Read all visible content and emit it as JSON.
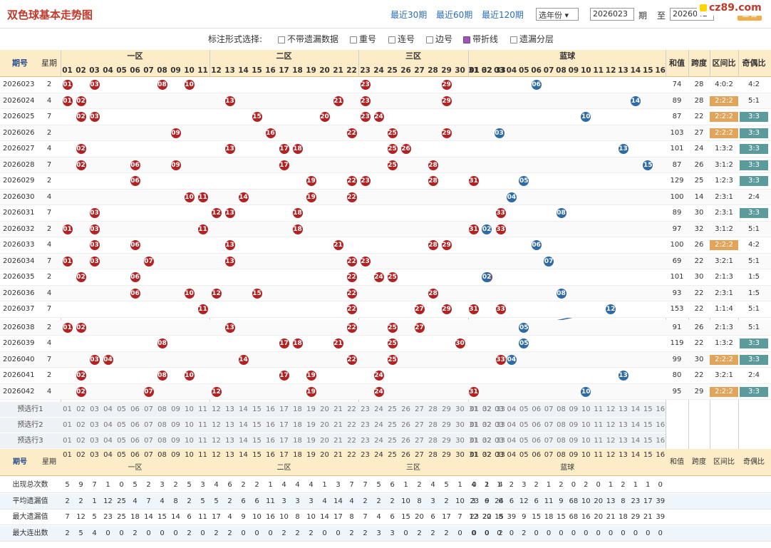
{
  "header": {
    "title": "双色球基本走势图",
    "recent": [
      "最近30期",
      "最近60期",
      "最近120期"
    ],
    "year_select": "选年份",
    "from_issue": "2026023",
    "issue_unit": "期",
    "to_label": "至",
    "to_issue": "2026042",
    "query": "查看",
    "watermark": "cz89.com"
  },
  "options": {
    "label": "标注形式选择:",
    "items": [
      {
        "label": "不带遗漏数据",
        "checked": false
      },
      {
        "label": "重号",
        "checked": false
      },
      {
        "label": "连号",
        "checked": false
      },
      {
        "label": "边号",
        "checked": false
      },
      {
        "label": "带折线",
        "checked": true
      },
      {
        "label": "遗漏分层",
        "checked": false
      }
    ]
  },
  "table": {
    "issue_header": "期号",
    "week_header": "星期",
    "zones": [
      "一区",
      "二区",
      "三区",
      "蓝球"
    ],
    "sum_header": "和值",
    "span_header": "跨度",
    "zone_ratio_header": "区间比",
    "odd_even_header": "奇偶比",
    "red_numbers": [
      "01",
      "02",
      "03",
      "04",
      "05",
      "06",
      "07",
      "08",
      "09",
      "10",
      "11",
      "12",
      "13",
      "14",
      "15",
      "16",
      "17",
      "18",
      "19",
      "20",
      "21",
      "22",
      "23",
      "24",
      "25",
      "26",
      "27",
      "28",
      "29",
      "30",
      "31",
      "32",
      "33"
    ],
    "blue_numbers": [
      "01",
      "02",
      "03",
      "04",
      "05",
      "06",
      "07",
      "08",
      "09",
      "10",
      "11",
      "12",
      "13",
      "14",
      "15",
      "16"
    ],
    "rows": [
      {
        "issue": "2026023",
        "week": "2",
        "red": [
          1,
          3,
          8,
          10,
          23,
          29
        ],
        "blue": 6,
        "sum": "74",
        "span": "28",
        "zone": "4:0:2",
        "oe": "4:2"
      },
      {
        "issue": "2026024",
        "week": "4",
        "red": [
          1,
          2,
          13,
          21,
          23,
          29
        ],
        "blue": 14,
        "sum": "89",
        "span": "28",
        "zone": "2:2:2",
        "oe": "5:1"
      },
      {
        "issue": "2026025",
        "week": "7",
        "red": [
          2,
          3,
          15,
          20,
          23,
          24
        ],
        "blue": 10,
        "sum": "87",
        "span": "22",
        "zone": "2:2:2",
        "oe": "3:3"
      },
      {
        "issue": "2026026",
        "week": "2",
        "red": [
          9,
          16,
          22,
          25,
          29
        ],
        "blue": 3,
        "sum": "103",
        "span": "27",
        "zone": "2:2:2",
        "oe": "3:3"
      },
      {
        "issue": "2026027",
        "week": "4",
        "red": [
          2,
          13,
          17,
          18,
          25,
          26
        ],
        "blue": 13,
        "sum": "101",
        "span": "24",
        "zone": "1:3:2",
        "oe": "3:3"
      },
      {
        "issue": "2026028",
        "week": "7",
        "red": [
          2,
          6,
          9,
          17,
          25,
          28
        ],
        "blue": 15,
        "sum": "87",
        "span": "26",
        "zone": "3:1:2",
        "oe": "3:3"
      },
      {
        "issue": "2026029",
        "week": "2",
        "red": [
          6,
          19,
          22,
          23,
          28,
          31
        ],
        "blue": 5,
        "sum": "129",
        "span": "25",
        "zone": "1:2:3",
        "oe": "3:3"
      },
      {
        "issue": "2026030",
        "week": "4",
        "red": [
          10,
          11,
          14,
          19,
          22
        ],
        "blue": 4,
        "sum": "100",
        "span": "14",
        "zone": "2:3:1",
        "oe": "2:4"
      },
      {
        "issue": "2026031",
        "week": "7",
        "red": [
          3,
          12,
          13,
          18,
          33
        ],
        "blue": 8,
        "sum": "89",
        "span": "30",
        "zone": "2:3:1",
        "oe": "3:3"
      },
      {
        "issue": "2026032",
        "week": "2",
        "red": [
          1,
          3,
          11,
          18,
          31,
          33
        ],
        "blue": 2,
        "sum": "97",
        "span": "32",
        "zone": "3:1:2",
        "oe": "5:1"
      },
      {
        "issue": "2026033",
        "week": "4",
        "red": [
          3,
          6,
          13,
          21,
          28,
          29
        ],
        "blue": 6,
        "sum": "100",
        "span": "26",
        "zone": "2:2:2",
        "oe": "4:2"
      },
      {
        "issue": "2026034",
        "week": "7",
        "red": [
          1,
          3,
          7,
          13,
          22,
          23
        ],
        "blue": 7,
        "sum": "69",
        "span": "22",
        "zone": "3:2:1",
        "oe": "5:1"
      },
      {
        "issue": "2026035",
        "week": "2",
        "red": [
          2,
          6,
          22,
          24,
          25,
          32
        ],
        "blue": 2,
        "sum": "101",
        "span": "30",
        "zone": "2:1:3",
        "oe": "1:5"
      },
      {
        "issue": "2026036",
        "week": "4",
        "red": [
          6,
          10,
          12,
          15,
          22,
          28
        ],
        "blue": 8,
        "sum": "93",
        "span": "22",
        "zone": "2:3:1",
        "oe": "1:5"
      },
      {
        "issue": "2026037",
        "week": "7",
        "red": [
          11,
          22,
          27,
          29,
          31,
          33
        ],
        "blue": 12,
        "sum": "153",
        "span": "22",
        "zone": "1:1:4",
        "oe": "5:1"
      },
      {
        "issue": "2026038",
        "week": "2",
        "red": [
          1,
          2,
          13,
          22,
          25,
          27
        ],
        "blue": 5,
        "sum": "91",
        "span": "26",
        "zone": "2:1:3",
        "oe": "5:1"
      },
      {
        "issue": "2026039",
        "week": "4",
        "red": [
          8,
          17,
          18,
          21,
          25,
          30
        ],
        "blue": 5,
        "sum": "119",
        "span": "22",
        "zone": "1:3:2",
        "oe": "3:3"
      },
      {
        "issue": "2026040",
        "week": "7",
        "red": [
          3,
          4,
          14,
          22,
          25,
          33
        ],
        "blue": 4,
        "sum": "99",
        "span": "30",
        "zone": "2:2:2",
        "oe": "3:3"
      },
      {
        "issue": "2026041",
        "week": "2",
        "red": [
          2,
          8,
          10,
          17,
          19,
          24
        ],
        "blue": 13,
        "sum": "80",
        "span": "22",
        "zone": "3:2:1",
        "oe": "2:4"
      },
      {
        "issue": "2026042",
        "week": "4",
        "red": [
          2,
          7,
          12,
          19,
          24,
          31
        ],
        "blue": 10,
        "sum": "95",
        "span": "29",
        "zone": "2:2:2",
        "oe": "3:3"
      }
    ],
    "preselect": [
      "预选行1",
      "预选行2",
      "预选行3"
    ],
    "stats": [
      {
        "label": "出现总次数",
        "red": "5 9 7 1 0 5 2 3 2 5 3 4 6 2 2 1 4 4 4 1 3 7 7 5 6 1 2 4 5 1 4 1 4",
        "blue": "0 2 1 2 3 2 1 2 0 2 0 1 2 1 1 0"
      },
      {
        "label": "平均遗漏值",
        "red": "2 2 1 12 25 4 7 4 8 2 5 5 2 6 6 11 3 3 3 4 14 4 2 2 2 10 8 3 2 10 3 9 6",
        "blue": "23 6 24 6 12 6 11 9 68 10 20 13 8 23 17 39"
      },
      {
        "label": "最大遗漏值",
        "red": "7 12 5 23 25 18 14 15 14 6 11 17 4 9 10 16 10 8 10 14 17 8 7 4 6 15 20 6 17 7 12 22 8",
        "blue": "23 20 15 39 9 15 18 15 68 16 20 21 18 29 21 39"
      },
      {
        "label": "最大连出数",
        "red": "2 5 4 0 0 2 0 0 0 2 0 2 2 0 0 0 2 2 2 0 0 2 2 3 3 0 2 2 2 0 0 0 2",
        "blue": "0 0 0 0 2 0 0 0 0 0 0 0 0 0 0 0"
      }
    ]
  },
  "colors": {
    "red_ball": "#b22222",
    "blue_ball": "#2e6aa6",
    "tag_orange": "#e0a45a",
    "tag_teal": "#5b9b9b",
    "header_bg": "#fdecc8"
  }
}
